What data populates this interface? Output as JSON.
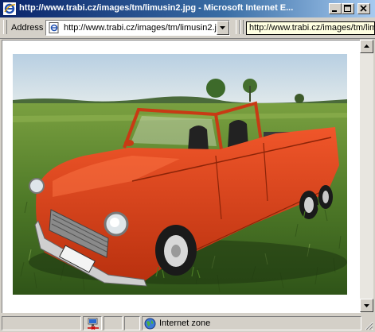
{
  "window": {
    "title": "http://www.trabi.cz/images/tm/limusin2.jpg - Microsoft Internet E...",
    "minimize_icon": "minimize-icon",
    "maximize_icon": "maximize-icon",
    "close_icon": "close-icon"
  },
  "address_bar": {
    "label": "Address",
    "value": "http://www.trabi.cz/images/tm/limusin2.j",
    "page_icon": "ie-page-icon",
    "dropdown_icon": "chevron-down-icon"
  },
  "tooltip": {
    "text": "http://www.trabi.cz/images/tm/lim"
  },
  "content": {
    "image_subject": "orange-red convertible limousine car on a grassy field",
    "colors": {
      "car": "#e0401a",
      "grass": "#5e8a2e",
      "sky": "#c8dcea"
    }
  },
  "status_bar": {
    "zone_text": "Internet zone",
    "zone_icon": "globe-icon",
    "network_icon": "network-icon"
  }
}
